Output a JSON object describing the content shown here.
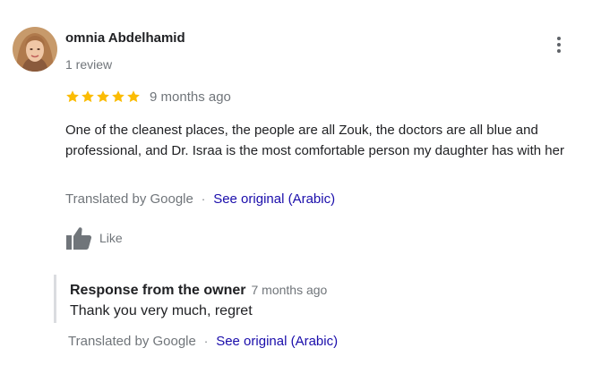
{
  "review": {
    "author_name": "omnia Abdelhamid",
    "review_count": "1 review",
    "rating": 5,
    "rating_max": 5,
    "date": "9 months ago",
    "text": "One of the cleanest places, the people are all Zouk, the doctors are all blue and professional, and Dr. Israa is the most comfortable person my daughter has with her",
    "translated_label": "Translated by Google",
    "separator": "·",
    "see_original_label": "See original (Arabic)",
    "like_label": "Like",
    "menu_icon": "more-vert-icon",
    "star_color": "#fbbc04"
  },
  "owner_response": {
    "title": "Response from the owner",
    "date": "7 months ago",
    "text": "Thank you very much, regret",
    "translated_label": "Translated by Google",
    "separator": "·",
    "see_original_label": "See original (Arabic)"
  },
  "colors": {
    "link": "#1a0dab",
    "secondary_text": "#70757a",
    "primary_text": "#202124"
  }
}
